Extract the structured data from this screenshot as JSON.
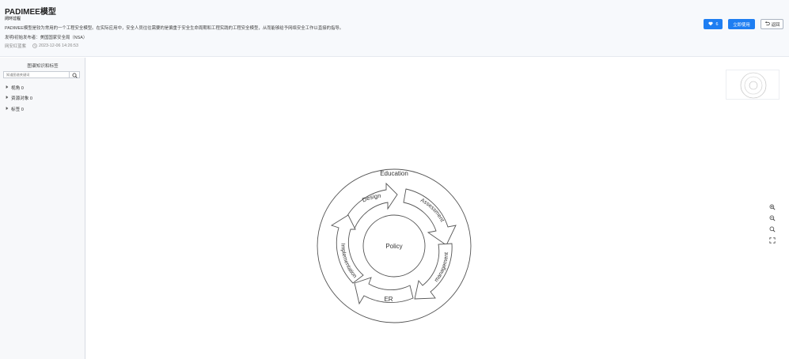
{
  "header": {
    "title": "PADIMEE模型",
    "subtitle": "闭环过程",
    "description": "PADIMEE模型是较为常用的一个工程安全模型。在实际应用中，安全人员往往需要的是偏重于安全生命周期和工程实践的工程安全模型，从而能够给予网络安全工作以直接的指导。",
    "publisher": "发明/初始发布者：美国国家安全局（NSA）",
    "author": "网安红蓝紫",
    "timestamp": "2023-12-06 14:26:53",
    "like_count": "6",
    "use_label": "立即使用",
    "back_label": "返回"
  },
  "sidebar": {
    "title": "图谱知识和标签",
    "search_placeholder": "知道图谱关键词",
    "items": [
      {
        "label": "视角 0"
      },
      {
        "label": "资源对象 0"
      },
      {
        "label": "标签 0"
      }
    ]
  },
  "diagram": {
    "center": "Policy",
    "stages": {
      "education": "Education",
      "design": "Design",
      "assessment": "Assessment",
      "management": "management",
      "er": "ER",
      "implementation": "Implementation"
    }
  },
  "icons": {
    "like": "heart-icon",
    "back": "undo-icon",
    "time": "clock-icon",
    "search": "search-icon",
    "expand": "caret-right-icon",
    "zoom_in": "zoom-in-icon",
    "zoom_out": "zoom-out-icon",
    "fit": "magnifier-icon",
    "fullscreen": "fullscreen-icon"
  },
  "colors": {
    "primary": "#1e7ef2",
    "header_bg": "#f7f9fc",
    "sidebar_bg": "#f7f8fa"
  }
}
